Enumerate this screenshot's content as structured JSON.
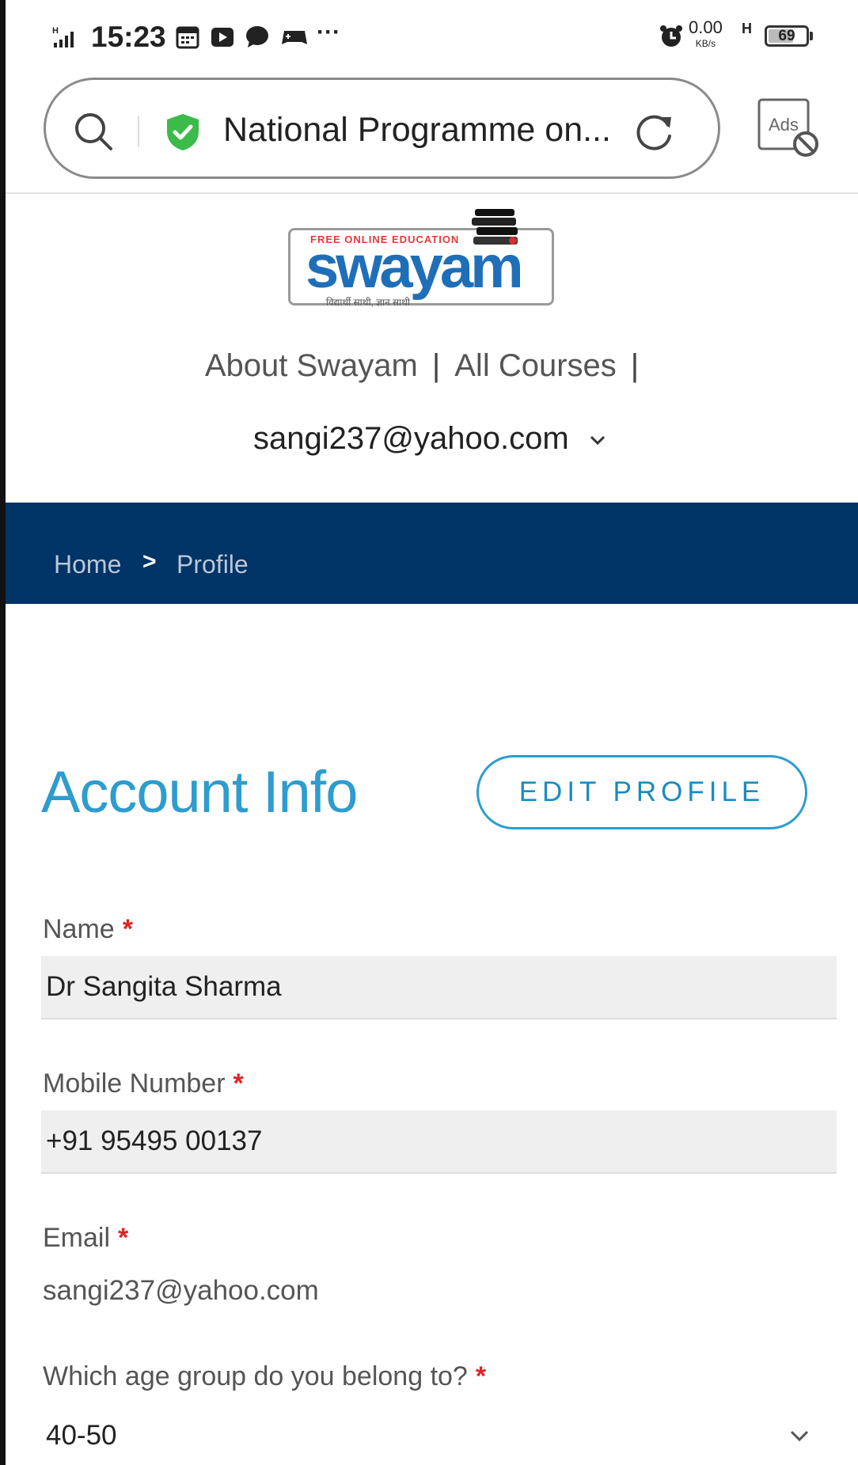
{
  "status_bar": {
    "time": "15:23",
    "net_speed": "0.00",
    "net_unit": "KB/s",
    "net_type": "H",
    "battery": "69",
    "battery_level": 0.69,
    "more": "···",
    "icons": [
      "signal-icon",
      "calendar-icon",
      "youtube-icon",
      "chat-icon",
      "gamepad-icon",
      "alarm-icon"
    ]
  },
  "browser": {
    "page_title": "National Programme on...",
    "ads_label": "Ads"
  },
  "site": {
    "logo_tag": "FREE ONLINE EDUCATION",
    "logo_word": "swayam",
    "logo_sub": "विद्यार्थी साथी, ज्ञान साथी"
  },
  "nav": {
    "links": [
      "About Swayam",
      "All Courses"
    ],
    "separator": "|",
    "user_email": "sangi237@yahoo.com"
  },
  "breadcrumb": {
    "items": [
      "Home",
      "Profile"
    ],
    "separator": ">"
  },
  "account": {
    "title": "Account Info",
    "edit_button": "EDIT PROFILE",
    "required_mark": "*",
    "fields": {
      "name_label": "Name",
      "name_value": "Dr Sangita Sharma",
      "mobile_label": "Mobile Number",
      "mobile_value": "+91 95495 00137",
      "email_label": "Email",
      "email_value": "sangi237@yahoo.com",
      "age_label": "Which age group do you belong to?",
      "age_value": "40-50"
    }
  },
  "colors": {
    "accent": "#2d9ccf",
    "breadcrumb_bg": "#003366",
    "required": "#e02424",
    "secure_green": "#3cba4a"
  }
}
